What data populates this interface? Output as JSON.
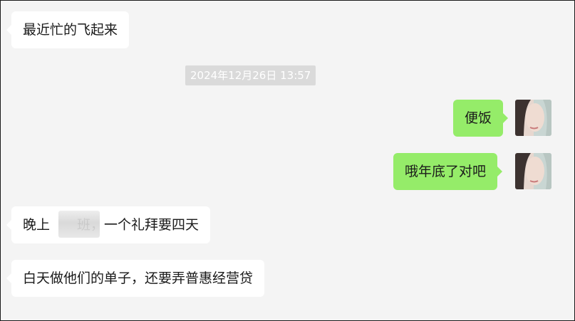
{
  "chat": {
    "timestamp": "2024年12月26日 13:57",
    "messages": [
      {
        "side": "incoming",
        "text": "最近忙的飞起来"
      },
      {
        "side": "outgoing",
        "text": "便饭"
      },
      {
        "side": "outgoing",
        "text": "哦年底了对吧"
      },
      {
        "side": "incoming",
        "text": "晚上 班，一个礼拜要四天",
        "note_visible_text": "晚上　　班，一个礼拜要四天"
      },
      {
        "side": "incoming",
        "text": "白天做他们的单子，还要弄普惠经营贷"
      }
    ]
  },
  "colors": {
    "background": "#f4f4f4",
    "incoming_bubble": "#ffffff",
    "outgoing_bubble": "#95ec69",
    "timestamp_bg": "#dadada",
    "timestamp_text": "#ffffff"
  },
  "icons": {
    "avatar": "user-avatar-photo"
  }
}
